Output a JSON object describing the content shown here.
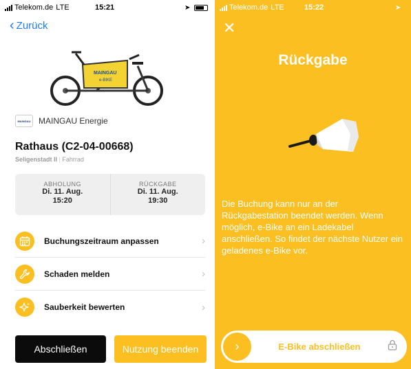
{
  "left": {
    "status": {
      "carrier": "Telekom.de",
      "network": "LTE",
      "time": "15:21"
    },
    "back_label": "Zurück",
    "provider": {
      "name": "MAINGAU Energie",
      "logo_text": "MAINGAU"
    },
    "title": "Rathaus (C2-04-00668)",
    "subtitle_location": "Seligenstadt II",
    "subtitle_type": "Fahrrad",
    "pickup": {
      "label": "ABHOLUNG",
      "date": "Di. 11. Aug.",
      "time": "15:20"
    },
    "return": {
      "label": "RÜCKGABE",
      "date": "Di. 11. Aug.",
      "time": "19:30"
    },
    "menu": [
      {
        "label": "Buchungszeitraum anpassen",
        "icon": "calendar-icon"
      },
      {
        "label": "Schaden melden",
        "icon": "wrench-icon"
      },
      {
        "label": "Sauberkeit bewerten",
        "icon": "sparkle-icon"
      }
    ],
    "buttons": {
      "lock": "Abschließen",
      "end": "Nutzung beenden"
    }
  },
  "right": {
    "status": {
      "carrier": "Telekom.de",
      "network": "LTE",
      "time": "15:22"
    },
    "title": "Rückgabe",
    "text": "Die Buchung kann nur an der Rückgabestation beendet werden. Wenn möglich, e-Bike an ein Ladekabel anschließen. So findet der nächste Nutzer ein geladenes e-Bike vor.",
    "slider_label": "E-Bike abschließen"
  },
  "colors": {
    "accent": "#fbbf22",
    "link": "#1a7ef0",
    "dark_button": "#0b0b0b"
  }
}
